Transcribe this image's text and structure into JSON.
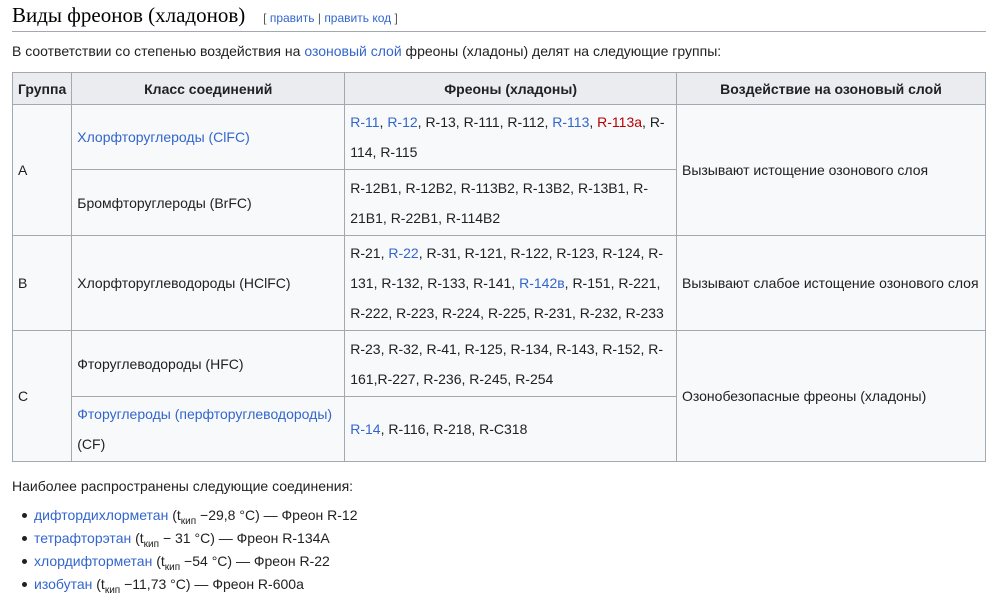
{
  "section": {
    "title": "Виды фреонов (хладонов)",
    "edit_open": "[",
    "edit_link": "править",
    "edit_sep": "|",
    "edit_code_link": "править код",
    "edit_close": "]"
  },
  "intro": {
    "before": "В соответствии со степенью воздействия на ",
    "link": "озоновый слой",
    "after": " фреоны (хладоны) делят на следующие группы:"
  },
  "table": {
    "headers": [
      "Группа",
      "Класс соединений",
      "Фреоны (хладоны)",
      "Воздействие на озоновый слой"
    ],
    "groups": [
      {
        "group": "A",
        "effect": "Вызывают истощение озонового слоя",
        "classes": [
          {
            "name": "Хлорфторуглероды (ClFC)",
            "name_is_link": true,
            "freons": [
              {
                "t": "R-11",
                "k": "link"
              },
              {
                "t": ", ",
                "k": "text"
              },
              {
                "t": "R-12",
                "k": "link"
              },
              {
                "t": ", R-13, R-111, R-112, ",
                "k": "text"
              },
              {
                "t": "R-113",
                "k": "link"
              },
              {
                "t": ", ",
                "k": "text"
              },
              {
                "t": "R-113a",
                "k": "new"
              },
              {
                "t": ", R-114, R-115",
                "k": "text"
              }
            ]
          },
          {
            "name": "Бромфторуглероды (BrFC)",
            "name_is_link": false,
            "freons": [
              {
                "t": "R-12B1, R-12B2, R-113B2, R-13B2, R-13B1, R-21B1, R-22B1, R-114B2",
                "k": "text"
              }
            ]
          }
        ]
      },
      {
        "group": "B",
        "effect": "Вызывают слабое истощение озонового слоя",
        "classes": [
          {
            "name": "Хлорфторуглеводороды (HClFC)",
            "name_is_link": false,
            "freons": [
              {
                "t": "R-21, ",
                "k": "text"
              },
              {
                "t": "R-22",
                "k": "link"
              },
              {
                "t": ", R-31, R-121, R-122, R-123, R-124, R-131, R-132, R-133, R-141, ",
                "k": "text"
              },
              {
                "t": "R-142в",
                "k": "link"
              },
              {
                "t": ", R-151, R-221, R-222, R-223, R-224, R-225, R-231, R-232, R-233",
                "k": "text"
              }
            ]
          }
        ]
      },
      {
        "group": "C",
        "effect": "Озонобезопасные фреоны (хладоны)",
        "classes": [
          {
            "name": "Фторуглеводороды (HFC)",
            "name_is_link": false,
            "freons": [
              {
                "t": "R-23, R-32, R-41, R-125, R-134, R-143, R-152, R-161,R-227, R-236, R-245, R-254",
                "k": "text"
              }
            ]
          },
          {
            "name": "Фторуглероды (перфторуглеводороды)",
            "name_suffix": " (CF)",
            "name_is_link": true,
            "freons": [
              {
                "t": "R-14",
                "k": "link"
              },
              {
                "t": ", R-116, R-218, R-C318",
                "k": "text"
              }
            ]
          }
        ]
      }
    ]
  },
  "below": "Наиболее распространены следующие соединения:",
  "compounds": [
    {
      "name": "дифтордихлорметан",
      "bp": "−29,8 °C",
      "freon": "Фреон R-12"
    },
    {
      "name": "тетрафторэтан",
      "bp": "− 31 °C",
      "freon": "Фреон R-134A"
    },
    {
      "name": "хлордифторметан",
      "bp": "−54 °C",
      "freon": "Фреон R-22"
    },
    {
      "name": "изобутан",
      "bp": "−11,73 °C",
      "freon": "Фреон R-600a"
    }
  ],
  "compound_parts": {
    "t": "t",
    "sub": "кип",
    "dash": " — "
  }
}
